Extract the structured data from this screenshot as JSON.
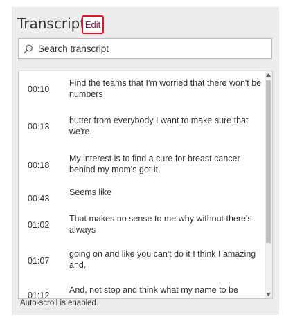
{
  "header": {
    "title": "Transcript",
    "edit_label": "Edit"
  },
  "search": {
    "placeholder": "Search transcript"
  },
  "transcript": [
    {
      "time": "00:10",
      "text": "Find the teams that I'm worried that there won't be numbers"
    },
    {
      "time": "00:13",
      "text": "butter from everybody I want to make sure that we're."
    },
    {
      "time": "00:18",
      "text": "My interest is to find a cure for breast cancer behind my mom's got it."
    },
    {
      "time": "00:43",
      "text": "Seems like"
    },
    {
      "time": "01:02",
      "text": "That makes no sense to me why without there's always"
    },
    {
      "time": "01:07",
      "text": "going on and like you can't do it I think I amazing and."
    },
    {
      "time": "01:12",
      "text": "And, not stop and think what my name to be"
    }
  ],
  "footer": {
    "status": "Auto-scroll is enabled."
  },
  "colors": {
    "edit_border": "#e81123",
    "edit_text": "#8a1a4a",
    "panel_bg": "#ececec"
  }
}
